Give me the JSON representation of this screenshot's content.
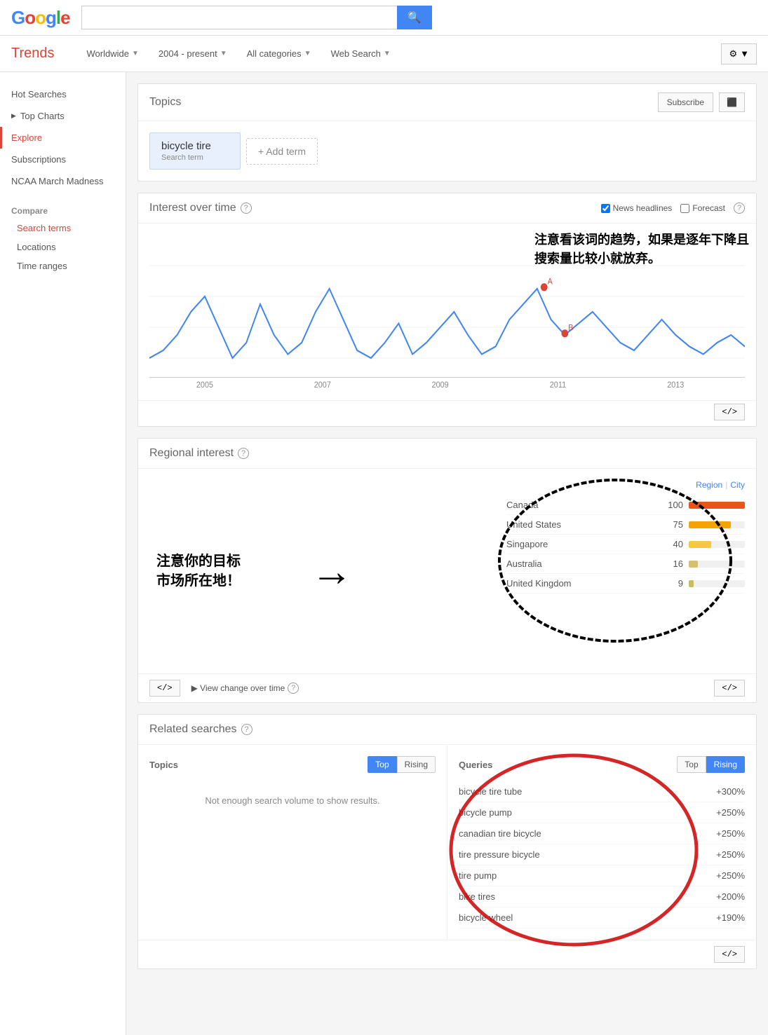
{
  "header": {
    "logo_letters": [
      "G",
      "o",
      "o",
      "g",
      "l",
      "e"
    ],
    "search_placeholder": "",
    "search_btn": "🔍"
  },
  "navbar": {
    "brand": "Trends",
    "filters": [
      {
        "label": "Worldwide",
        "id": "filter-worldwide"
      },
      {
        "label": "2004 - present",
        "id": "filter-date"
      },
      {
        "label": "All categories",
        "id": "filter-categories"
      },
      {
        "label": "Web Search",
        "id": "filter-type"
      }
    ],
    "settings_btn": "⚙"
  },
  "sidebar": {
    "items": [
      {
        "label": "Hot Searches",
        "id": "hot-searches",
        "active": false
      },
      {
        "label": "Top Charts",
        "id": "top-charts",
        "active": false,
        "arrow": true
      },
      {
        "label": "Explore",
        "id": "explore",
        "active": true
      },
      {
        "label": "Subscriptions",
        "id": "subscriptions",
        "active": false
      },
      {
        "label": "NCAA March Madness",
        "id": "ncaa",
        "active": false
      }
    ],
    "compare_section": "Compare",
    "compare_items": [
      {
        "label": "Search terms",
        "id": "search-terms",
        "active": true
      },
      {
        "label": "Locations",
        "id": "locations",
        "active": false
      },
      {
        "label": "Time ranges",
        "id": "time-ranges",
        "active": false
      }
    ]
  },
  "topics_section": {
    "title": "Topics",
    "subscribe_btn": "Subscribe",
    "share_btn": "⬛",
    "chip": {
      "term": "bicycle tire",
      "label": "Search term"
    },
    "add_term_btn": "+ Add term"
  },
  "interest_section": {
    "title": "Interest over time",
    "news_label": "News headlines",
    "forecast_label": "Forecast",
    "annotation_chinese": "注意看该词的趋势，如果是逐年下降且\n搜索量比较小就放弃。",
    "year_labels": [
      "2005",
      "2007",
      "2009",
      "2011",
      "2013"
    ],
    "embed_btn": "</>",
    "point_a": "A",
    "point_b": "B"
  },
  "regional_section": {
    "title": "Regional interest",
    "annotation_left": "注意你的目标\n市场所在地！",
    "region_label": "Region",
    "city_label": "City",
    "regions": [
      {
        "name": "Canada",
        "score": 100,
        "color": "#E8541A",
        "pct": 100
      },
      {
        "name": "United States",
        "score": 75,
        "color": "#F4A300",
        "pct": 75
      },
      {
        "name": "Singapore",
        "score": 40,
        "color": "#F4C842",
        "pct": 40
      },
      {
        "name": "Australia",
        "score": 16,
        "color": "#D4C070",
        "pct": 16
      },
      {
        "name": "United Kingdom",
        "score": 9,
        "color": "#C8BC60",
        "pct": 9
      }
    ],
    "view_change_btn": "▶ View change over time",
    "embed_btn_left": "</>",
    "embed_btn_right": "</>"
  },
  "related_section": {
    "title": "Related searches",
    "topics_label": "Topics",
    "queries_label": "Queries",
    "top_btn": "Top",
    "rising_btn": "Rising",
    "no_results": "Not enough search volume to show results.",
    "queries": [
      {
        "name": "bicycle tire tube",
        "pct": "+300%"
      },
      {
        "name": "bicycle pump",
        "pct": "+250%"
      },
      {
        "name": "canadian tire bicycle",
        "pct": "+250%"
      },
      {
        "name": "tire pressure bicycle",
        "pct": "+250%"
      },
      {
        "name": "tire pump",
        "pct": "+250%"
      },
      {
        "name": "bike tires",
        "pct": "+200%"
      },
      {
        "name": "bicycle wheel",
        "pct": "+190%"
      }
    ],
    "embed_btn": "</>"
  }
}
